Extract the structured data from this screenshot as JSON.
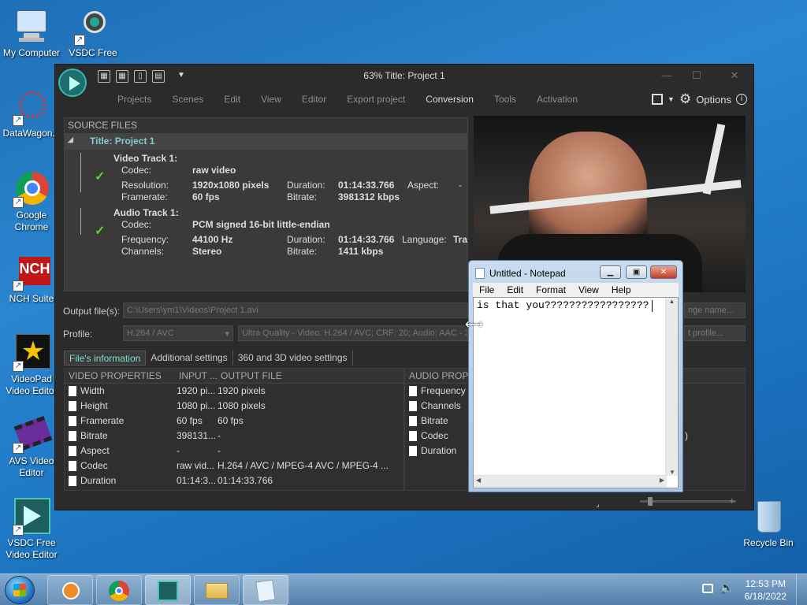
{
  "desktop": {
    "icons": [
      {
        "label": "My Computer"
      },
      {
        "label": "VSDC Free Video C..."
      },
      {
        "label": "DataWagon..."
      },
      {
        "label": "Google Chrome"
      },
      {
        "label": "NCH Suite"
      },
      {
        "label": "VideoPad Video Editor"
      },
      {
        "label": "AVS Video Editor"
      },
      {
        "label": "VSDC Free Video Editor"
      },
      {
        "label": "Recycle Bin"
      }
    ]
  },
  "vsdc": {
    "title": "63% Title: Project 1",
    "menu": [
      "Projects",
      "Scenes",
      "Edit",
      "View",
      "Editor",
      "Export project",
      "Conversion",
      "Tools",
      "Activation"
    ],
    "active_menu": "Conversion",
    "options_label": "Options",
    "source": {
      "header": "SOURCE FILES",
      "project": "Title: Project 1",
      "video_track": "Video Track 1:",
      "codec_label": "Codec:",
      "video_codec": "raw video",
      "resolution_label": "Resolution:",
      "resolution": "1920x1080 pixels",
      "duration_label": "Duration:",
      "video_duration": "01:14:33.766",
      "aspect_label": "Aspect:",
      "aspect": "-",
      "framerate_label": "Framerate:",
      "framerate": "60 fps",
      "bitrate_label": "Bitrate:",
      "video_bitrate": "3981312 kbps",
      "audio_track": "Audio Track 1:",
      "audio_codec": "PCM signed 16-bit little-endian",
      "frequency_label": "Frequency:",
      "frequency": "44100 Hz",
      "audio_duration": "01:14:33.766",
      "language_label": "Language:",
      "language": "Tra",
      "channels_label": "Channels:",
      "channels": "Stereo",
      "audio_bitrate": "1411 kbps"
    },
    "output": {
      "label": "Output file(s):",
      "path": "C:\\Users\\ym1\\Videos\\Project 1.avi",
      "change_name": "nge name...",
      "profile_label": "Profile:",
      "profile": "H.264 / AVC",
      "quality": "Ultra Quality - Video: H.264 / AVC; CRF: 20; Audio: AAC - 3...",
      "edit_profile": "t profile..."
    },
    "tabs": [
      "File's information",
      "Additional settings",
      "360 and 3D video settings"
    ],
    "video_props": {
      "headers": [
        "VIDEO PROPERTIES",
        "INPUT ...",
        "OUTPUT FILE"
      ],
      "rows": [
        [
          "Width",
          "1920 pi...",
          "1920 pixels"
        ],
        [
          "Height",
          "1080 pi...",
          "1080 pixels"
        ],
        [
          "Framerate",
          "60 fps",
          "60 fps"
        ],
        [
          "Bitrate",
          "398131...",
          "-"
        ],
        [
          "Aspect",
          "-",
          "-"
        ],
        [
          "Codec",
          "raw vid...",
          "H.264 / AVC / MPEG-4 AVC / MPEG-4 ..."
        ],
        [
          "Duration",
          "01:14:3...",
          "01:14:33.766"
        ]
      ]
    },
    "audio_props": {
      "header": "AUDIO PROPE",
      "rows": [
        "Frequency",
        "Channels",
        "Bitrate",
        "Codec",
        "Duration"
      ],
      "fragment": ")"
    }
  },
  "notepad": {
    "title": "Untitled - Notepad",
    "menu": [
      "File",
      "Edit",
      "Format",
      "View",
      "Help"
    ],
    "text": "is that you?????????????????"
  },
  "taskbar": {
    "time": "12:53 PM",
    "date": "6/18/2022"
  },
  "colors": {
    "accent_teal": "#7fe0d0",
    "check_green": "#5fcf3c"
  }
}
